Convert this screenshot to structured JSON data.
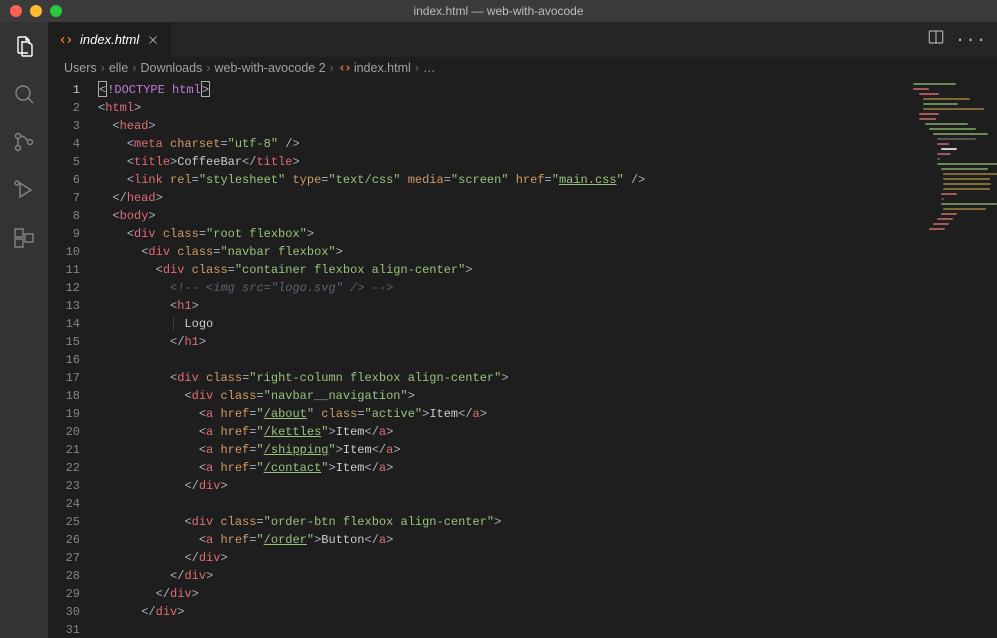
{
  "window": {
    "title": "index.html — web-with-avocode"
  },
  "tab": {
    "label": "index.html"
  },
  "breadcrumbs": {
    "parts": [
      "Users",
      "elle",
      "Downloads",
      "web-with-avocode 2"
    ],
    "file": "index.html",
    "tail": "…"
  },
  "lines": {
    "count": 31,
    "current": 1
  },
  "code": {
    "l1_doctype": "DOCTYPE html",
    "title_text": "CoffeeBar",
    "meta_charset": "utf-8",
    "link_rel": "stylesheet",
    "link_type": "text/css",
    "link_media": "screen",
    "link_href": "main.css",
    "cls_root": "root flexbox",
    "cls_navbar": "navbar flexbox",
    "cls_container": "container flexbox align-center",
    "comment_img": "<!-- <img src=\"logo.svg\" /> -->",
    "logo_text": "Logo",
    "cls_rightcol": "right-column flexbox align-center",
    "cls_navnav": "navbar__navigation",
    "href_about": "/about",
    "cls_active": "active",
    "href_kettles": "/kettles",
    "href_shipping": "/shipping",
    "href_contact": "/contact",
    "item_text": "Item",
    "cls_orderbtn": "order-btn flexbox align-center",
    "href_order": "/order",
    "button_text": "Button"
  }
}
